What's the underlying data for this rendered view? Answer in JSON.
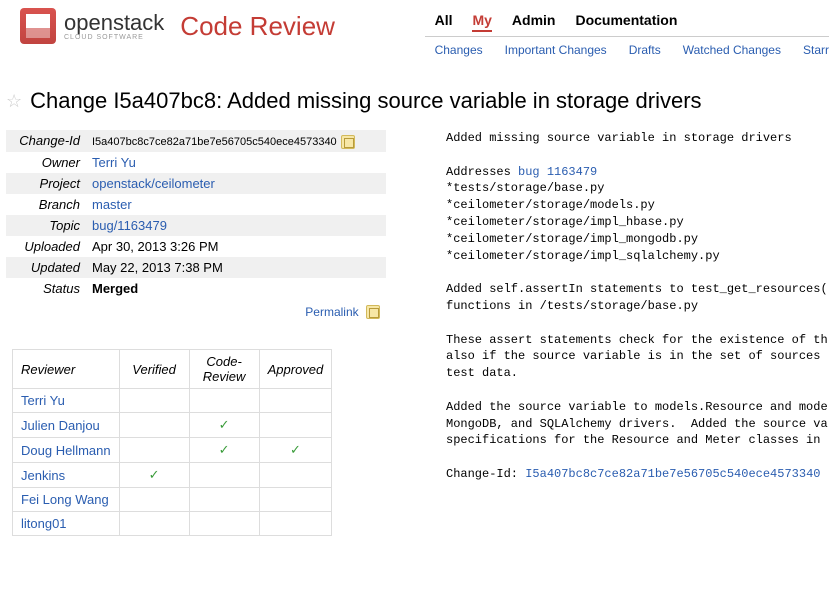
{
  "header": {
    "brand": "openstack",
    "brand_sub": "CLOUD SOFTWARE",
    "app": "Code Review",
    "nav_top": [
      "All",
      "My",
      "Admin",
      "Documentation"
    ],
    "nav_top_active": 1,
    "nav_sub": [
      "Changes",
      "Important Changes",
      "Drafts",
      "Watched Changes",
      "Starr"
    ]
  },
  "title": "Change I5a407bc8: Added missing source variable in storage drivers",
  "meta": {
    "change_id_label": "Change-Id",
    "change_id": "I5a407bc8c7ce82a71be7e56705c540ece4573340",
    "owner_label": "Owner",
    "owner": "Terri Yu",
    "project_label": "Project",
    "project": "openstack/ceilometer",
    "branch_label": "Branch",
    "branch": "master",
    "topic_label": "Topic",
    "topic": "bug/1163479",
    "uploaded_label": "Uploaded",
    "uploaded": "Apr 30, 2013 3:26 PM",
    "updated_label": "Updated",
    "updated": "May 22, 2013 7:38 PM",
    "status_label": "Status",
    "status": "Merged",
    "permalink": "Permalink"
  },
  "commit": {
    "l1": "Added missing source variable in storage drivers",
    "l2": "Addresses ",
    "bug": "bug 1163479",
    "l3": "*tests/storage/base.py",
    "l4": "*ceilometer/storage/models.py",
    "l5": "*ceilometer/storage/impl_hbase.py",
    "l6": "*ceilometer/storage/impl_mongodb.py",
    "l7": "*ceilometer/storage/impl_sqlalchemy.py",
    "l8": "Added self.assertIn statements to test_get_resources(",
    "l9": "functions in /tests/storage/base.py",
    "l10": "These assert statements check for the existence of th",
    "l11": "also if the source variable is in the set of sources ",
    "l12": "test data.",
    "l13": "Added the source variable to models.Resource and mode",
    "l14": "MongoDB, and SQLAlchemy drivers.  Added the source va",
    "l15": "specifications for the Resource and Meter classes in ",
    "cid_label": "Change-Id: ",
    "cid": "I5a407bc8c7ce82a71be7e56705c540ece4573340"
  },
  "reviewers": {
    "headers": [
      "Reviewer",
      "Verified",
      "Code-Review",
      "Approved"
    ],
    "rows": [
      {
        "name": "Terri Yu",
        "verified": "",
        "review": "",
        "approved": ""
      },
      {
        "name": "Julien Danjou",
        "verified": "",
        "review": "✓",
        "approved": ""
      },
      {
        "name": "Doug Hellmann",
        "verified": "",
        "review": "✓",
        "approved": "✓"
      },
      {
        "name": "Jenkins",
        "verified": "✓",
        "review": "",
        "approved": ""
      },
      {
        "name": "Fei Long Wang",
        "verified": "",
        "review": "",
        "approved": ""
      },
      {
        "name": "litong01",
        "verified": "",
        "review": "",
        "approved": ""
      }
    ]
  }
}
